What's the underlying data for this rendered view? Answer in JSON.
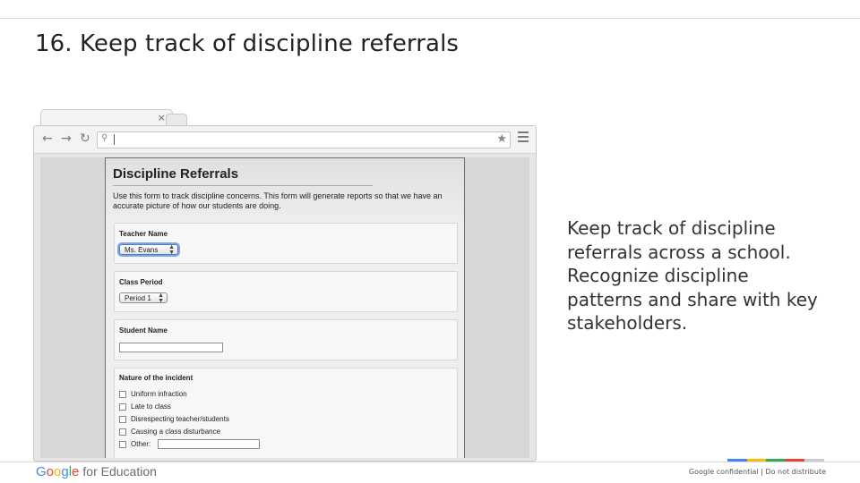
{
  "slide": {
    "title": "16. Keep track of discipline referrals",
    "description": "Keep track of discipline referrals across a school. Recognize discipline patterns and share with key stakeholders."
  },
  "browser": {
    "tab_close": "×",
    "icons": {
      "back": "arrow-left",
      "forward": "arrow-right",
      "reload": "refresh",
      "search": "magnifier",
      "bookmark": "star",
      "menu": "hamburger"
    }
  },
  "form": {
    "title": "Discipline Referrals",
    "description": "Use this form to track discipline concerns.  This form will generate reports so that we have an accurate picture of how our students are doing.",
    "questions": {
      "teacher": {
        "label": "Teacher Name",
        "value": "Ms. Evans"
      },
      "period": {
        "label": "Class Period",
        "value": "Period 1"
      },
      "student": {
        "label": "Student Name",
        "value": ""
      },
      "incident": {
        "label": "Nature of the incident",
        "options": [
          "Uniform infraction",
          "Late to class",
          "Disrespecting teacher/students",
          "Causing a class disturbance",
          "Other:"
        ]
      }
    }
  },
  "footer": {
    "logo_google": "Google",
    "logo_suffix": "for Education",
    "confidential": "Google confidential | Do not distribute",
    "brand_colors": [
      "#4285f4",
      "#fbbc05",
      "#34a853",
      "#ea4335",
      "#cccccc"
    ],
    "google_letter_colors": [
      "#4285f4",
      "#ea4335",
      "#fbbc05",
      "#4285f4",
      "#34a853",
      "#ea4335"
    ]
  }
}
